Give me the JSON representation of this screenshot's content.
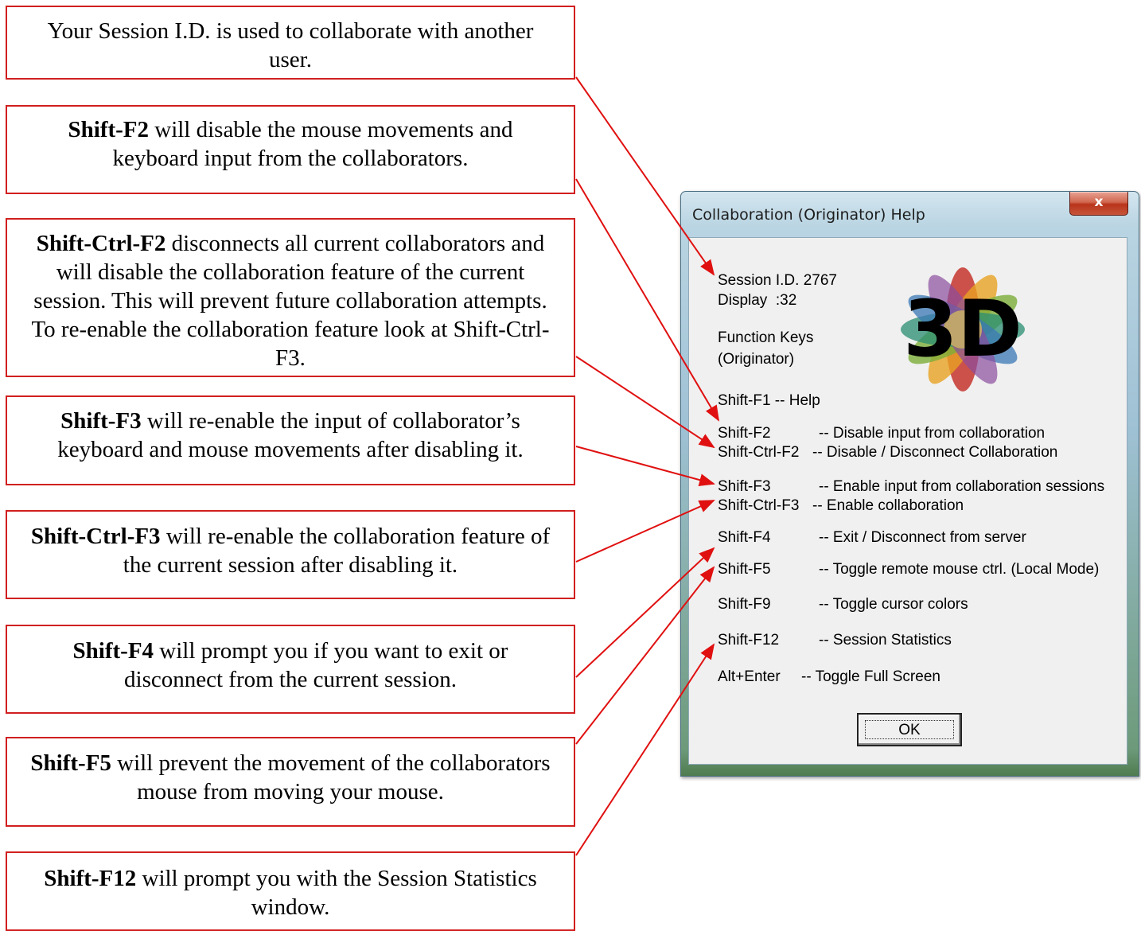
{
  "callouts": [
    {
      "bold": "",
      "text": "Your Session I.D. is used to collaborate with another user."
    },
    {
      "bold": "Shift-F2",
      "text": " will disable the mouse movements and keyboard input from the collaborators."
    },
    {
      "bold": "Shift-Ctrl-F2",
      "text": " disconnects all current collaborators and will disable the collaboration feature of the current session.  This will prevent future collaboration attempts.  To re-enable the collaboration feature look at Shift-Ctrl-F3."
    },
    {
      "bold": "Shift-F3",
      "text": " will re-enable the input of collaborator’s keyboard and mouse movements after disabling it."
    },
    {
      "bold": "Shift-Ctrl-F3",
      "text": " will re-enable the collaboration feature of the current session after disabling it."
    },
    {
      "bold": "Shift-F4",
      "text": " will prompt you if you want to exit or disconnect from the current session."
    },
    {
      "bold": "Shift-F5",
      "text": " will prevent the movement of the collaborators mouse from moving your mouse."
    },
    {
      "bold": "Shift-F12",
      "text": " will prompt you with the Session Statistics window."
    }
  ],
  "dialog": {
    "title": "Collaboration (Originator) Help",
    "close_label": "x",
    "session_id": "Session I.D. 2767",
    "display": "Display  :32",
    "function_keys_line1": "Function Keys",
    "function_keys_line2": "(Originator)",
    "help_line": "Shift-F1 -- Help",
    "shortcuts": [
      {
        "key": "Shift-F2",
        "desc": "-- Disable input from collaboration"
      },
      {
        "key": "Shift-Ctrl-F2",
        "desc": "-- Disable / Disconnect Collaboration"
      },
      {
        "key": "Shift-F3",
        "desc": "-- Enable input from collaboration sessions"
      },
      {
        "key": "Shift-Ctrl-F3",
        "desc": "-- Enable collaboration"
      },
      {
        "key": "Shift-F4",
        "desc": "-- Exit / Disconnect from server"
      },
      {
        "key": "Shift-F5",
        "desc": "-- Toggle remote mouse ctrl. (Local Mode)"
      },
      {
        "key": "Shift-F9",
        "desc": "-- Toggle cursor colors"
      },
      {
        "key": "Shift-F12",
        "desc": "-- Session Statistics"
      },
      {
        "key": "Alt+Enter",
        "desc": "-- Toggle Full Screen"
      }
    ],
    "logo_text": "3D",
    "ok_label": "OK"
  },
  "colors": {
    "arrow": "#e01010",
    "callout_border": "#d11f1f"
  }
}
